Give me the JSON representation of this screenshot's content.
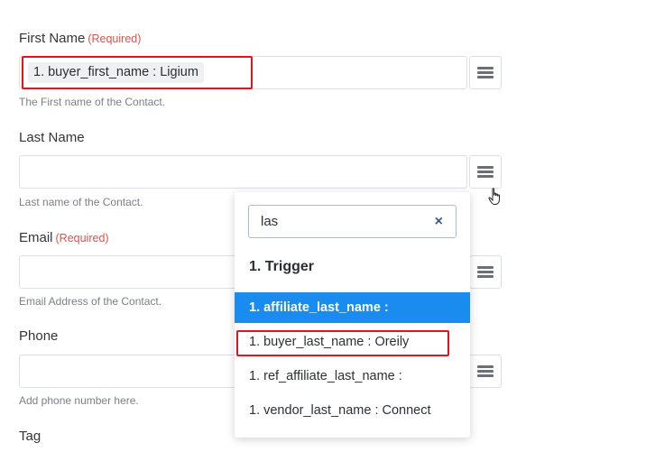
{
  "fields": [
    {
      "label": "First Name",
      "required": "(Required)",
      "value": "1. buyer_first_name : Ligium",
      "help": "The First name of the Contact."
    },
    {
      "label": "Last Name",
      "required": "",
      "value": "",
      "help": "Last name of the Contact."
    },
    {
      "label": "Email",
      "required": "(Required)",
      "value": "",
      "help": "Email Address of the Contact."
    },
    {
      "label": "Phone",
      "required": "",
      "value": "",
      "help": "Add phone number here."
    },
    {
      "label": "Tag",
      "required": "",
      "value": "",
      "help": ""
    }
  ],
  "dropdown": {
    "search_value": "las",
    "clear_icon": "×",
    "group_title": "1. Trigger",
    "options": [
      {
        "label": "1. affiliate_last_name :",
        "selected": true
      },
      {
        "label": "1. buyer_last_name : Oreily",
        "selected": false
      },
      {
        "label": "1. ref_affiliate_last_name :",
        "selected": false
      },
      {
        "label": "1. vendor_last_name : Connect",
        "selected": false
      }
    ]
  },
  "icons": {
    "menu": "hamburger-menu-icon",
    "cursor": "hand-pointer-icon",
    "clear": "close-icon"
  },
  "colors": {
    "required": "#d9534f",
    "highlight": "#e2141c",
    "selected_option": "#1a8cf0"
  }
}
